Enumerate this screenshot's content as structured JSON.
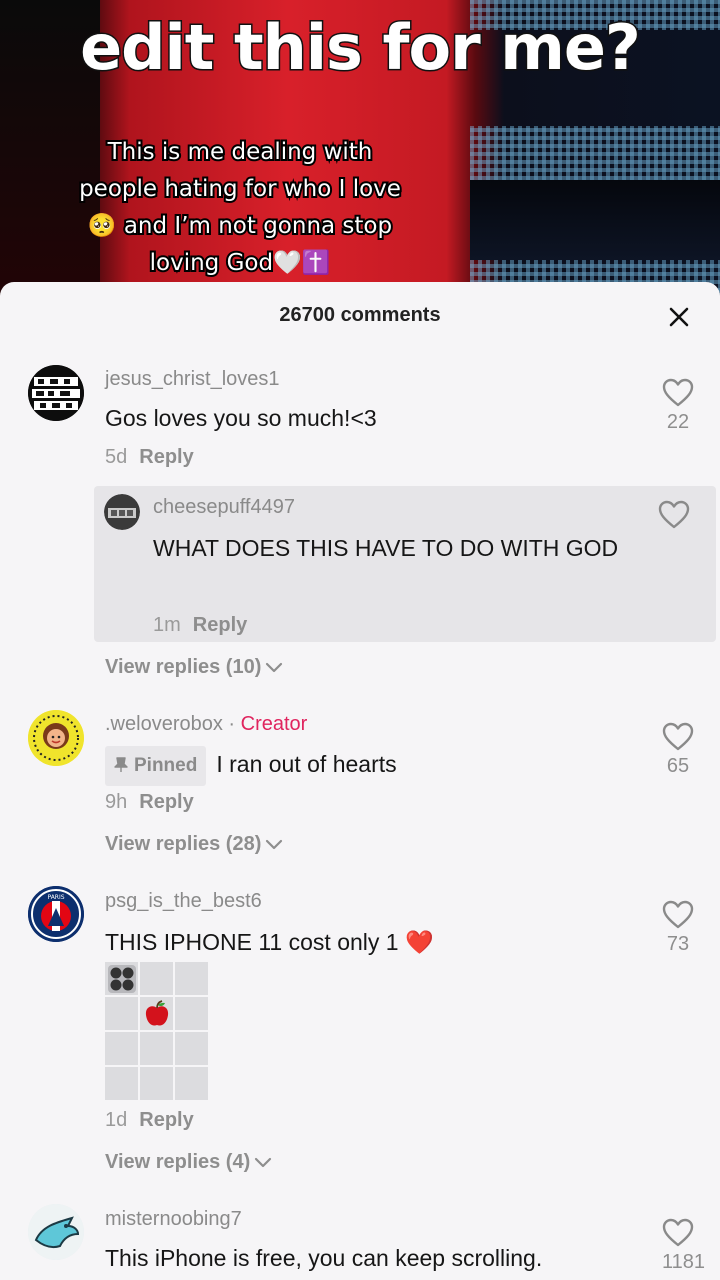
{
  "video": {
    "title": "edit this for me?",
    "caption_lines": [
      "This is me dealing with",
      "people hating for who I love",
      "🥺 and I’m not gonna stop",
      "loving God🤍✝️"
    ]
  },
  "sheet": {
    "count_label": "26700 comments",
    "close_icon": "close-icon"
  },
  "comments": [
    {
      "username": "jesus_christ_loves1",
      "text": "Gos loves you so much!<3",
      "age": "5d",
      "reply_label": "Reply",
      "likes": "22",
      "reply": {
        "username": "cheesepuff4497",
        "text": "WHAT DOES THIS HAVE TO DO WITH GOD",
        "age": "1m",
        "reply_label": "Reply"
      },
      "view_replies": "View replies (10)"
    },
    {
      "username": ".weloverobox",
      "separator": " · ",
      "creator_label": "Creator",
      "pinned_label": "Pinned",
      "text": "I ran out of hearts",
      "age": "9h",
      "reply_label": "Reply",
      "likes": "65",
      "view_replies": "View replies (28)"
    },
    {
      "username": "psg_is_the_best6",
      "text": "THIS IPHONE 11 cost only 1 ❤️",
      "age": "1d",
      "reply_label": "Reply",
      "likes": "73",
      "view_replies": "View replies (4)"
    },
    {
      "username": "misternoobing7",
      "text": "This iPhone is free, you can keep scrolling.",
      "likes": "1181"
    }
  ],
  "colors": {
    "creator": "#e0245e",
    "sheet_bg": "#f6f5f7",
    "muted": "#8e8e8e"
  }
}
